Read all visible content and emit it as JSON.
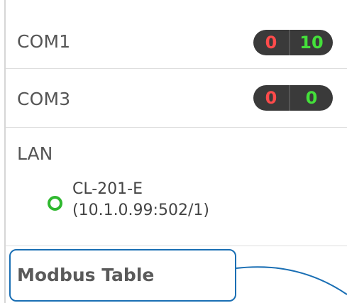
{
  "ports": [
    {
      "name": "COM1",
      "errors": "0",
      "success": "10"
    },
    {
      "name": "COM3",
      "errors": "0",
      "success": "0"
    }
  ],
  "lan": {
    "label": "LAN",
    "device": {
      "name": "CL-201-E",
      "address": "(10.1.0.99:502/1)",
      "status": "online",
      "status_color": "#2fb82f"
    }
  },
  "modbus_table": {
    "label": "Modbus Table",
    "highlight_color": "#1a6fb4"
  },
  "colors": {
    "error": "#ff4b4b",
    "success": "#44e03a",
    "counter_bg": "#3a3a3a"
  }
}
